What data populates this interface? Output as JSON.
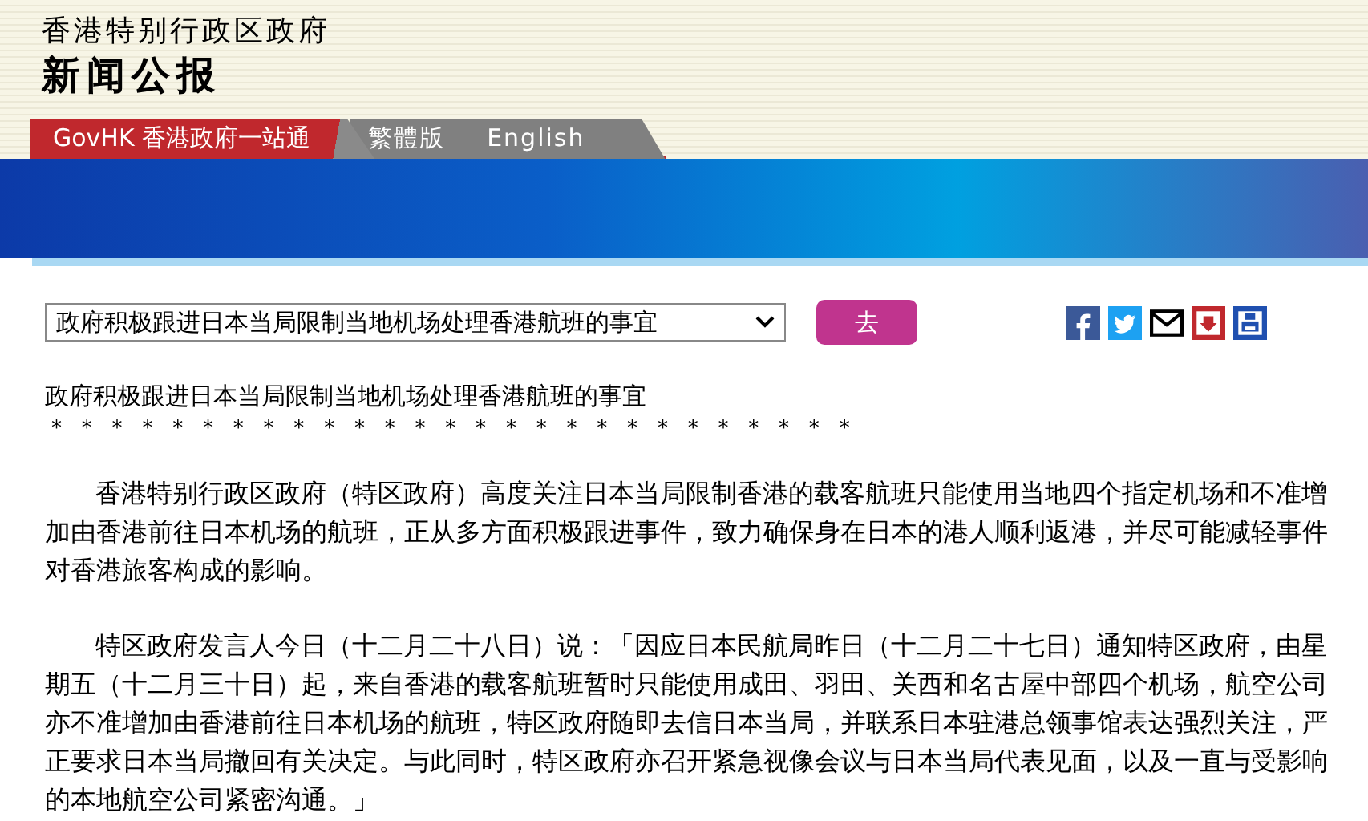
{
  "header": {
    "department": "香港特别行政区政府",
    "title": "新闻公报"
  },
  "nav": [
    {
      "label": "GovHK 香港政府一站通",
      "kind": "portal"
    },
    {
      "label": "繁體版",
      "kind": "language"
    },
    {
      "label": "English",
      "kind": "language"
    }
  ],
  "article_picker": {
    "value": "政府积极跟进日本当局限制当地机场处理香港航班的事宜",
    "button": "去"
  },
  "share_icons": [
    {
      "kind": "facebook"
    },
    {
      "kind": "twitter"
    },
    {
      "kind": "email"
    },
    {
      "kind": "save"
    },
    {
      "kind": "print"
    }
  ],
  "article": {
    "title": "政府积极跟进日本当局限制当地机场处理香港航班的事宜",
    "separator": "*   *   *   *   *   *   *   *   *   *   *   *   *   *   *   *   *   *   *   *   *   *   *   *   *   *   *",
    "paragraphs": [
      "香港特别行政区政府（特区政府）高度关注日本当局限制香港的载客航班只能使用当地四个指定机场和不准增加由香港前往日本机场的航班，正从多方面积极跟进事件，致力确保身在日本的港人顺利返港，并尽可能减轻事件对香港旅客构成的影响。",
      "特区政府发言人今日（十二月二十八日）说：「因应日本民航局昨日（十二月二十七日）通知特区政府，由星期五（十二月三十日）起，来自香港的载客航班暂时只能使用成田、羽田、关西和名古屋中部四个机场，航空公司亦不准增加由香港前往日本机场的航班，特区政府随即去信日本当局，并联系日本驻港总领事馆表达强烈关注，严正要求日本当局撤回有关决定。与此同时，特区政府亦召开紧急视像会议与日本当局代表见面，以及一直与受影响的本地航空公司紧密沟通。」"
    ]
  }
}
